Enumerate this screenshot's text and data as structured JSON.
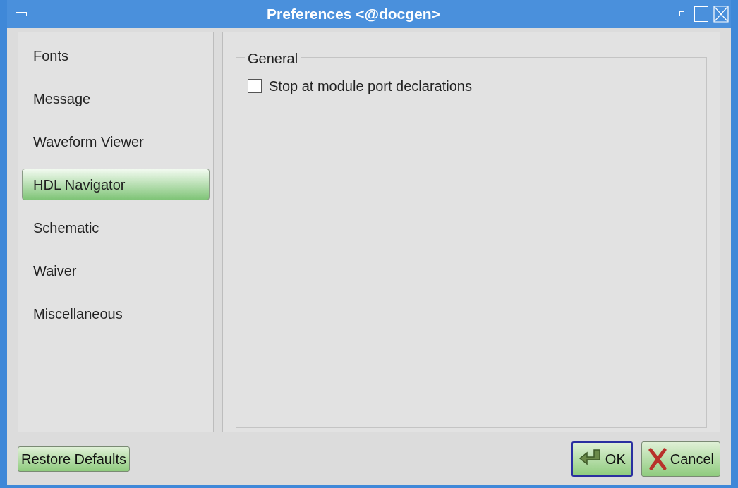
{
  "window": {
    "title": "Preferences <@docgen>"
  },
  "sidebar": {
    "items": [
      {
        "label": "Fonts",
        "selected": false
      },
      {
        "label": "Message",
        "selected": false
      },
      {
        "label": "Waveform Viewer",
        "selected": false
      },
      {
        "label": "HDL Navigator",
        "selected": true
      },
      {
        "label": "Schematic",
        "selected": false
      },
      {
        "label": "Waiver",
        "selected": false
      },
      {
        "label": "Miscellaneous",
        "selected": false
      }
    ]
  },
  "group": {
    "title": "General",
    "options": [
      {
        "label": "Stop at module port declarations",
        "checked": false
      }
    ]
  },
  "buttons": [
    {
      "label": "Restore Defaults",
      "kind": "plain",
      "default": false
    },
    {
      "label": "OK",
      "kind": "ok",
      "default": true
    },
    {
      "label": "Cancel",
      "kind": "cancel",
      "default": false
    }
  ]
}
